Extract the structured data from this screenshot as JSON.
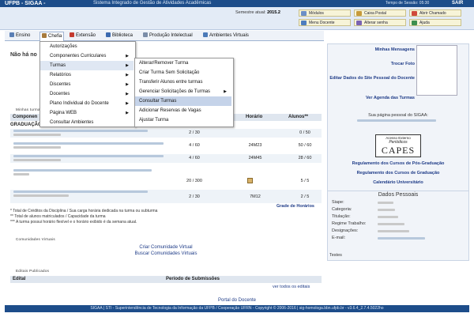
{
  "header": {
    "brand": "UFPB - SIGAA -",
    "subtitle": "Sistema Integrado de Gestão de Atividades Acadêmicas",
    "timer": "Tempo de Sessão: 05:30",
    "logout": "SAIR",
    "semester_label": "Semestre atual:",
    "semester_value": "2015.2"
  },
  "quick_links": [
    {
      "label": "Módulos",
      "color": "#6b8fc7"
    },
    {
      "label": "Caixa Postal",
      "color": "#c79a3b"
    },
    {
      "label": "Abrir Chamado",
      "color": "#d04a3a"
    },
    {
      "label": "Menu Docente",
      "color": "#4c7dbf"
    },
    {
      "label": "Alterar senha",
      "color": "#7a63b2"
    },
    {
      "label": "Ajuda",
      "color": "#3d8f4f"
    }
  ],
  "menu": [
    "Ensino",
    "Chefia",
    "Extensão",
    "Biblioteca",
    "Produção Intelectual",
    "Ambientes Virtuais"
  ],
  "chefia_menu": [
    "Autorizações",
    "Componentes Curriculares",
    "Turmas",
    "Relatórios",
    "Discentes",
    "Docentes",
    "Plano Individual do Docente",
    "Página WEB",
    "Consultar Ambientes"
  ],
  "turmas_menu": [
    "Alterar/Remover Turma",
    "Criar Turma Sem Solicitação",
    "Transferir Alunos entre turmas",
    "Gerenciar Solicitações de Turmas",
    "Consultar Turmas",
    "Adicionar Reservas de Vagas",
    "Ajustar Turma"
  ],
  "main": {
    "notice": "Não há no",
    "minhas_turmas_title": "Minhas turmas",
    "table_headers": {
      "componente": "Componen",
      "horario": "Horário",
      "alunos": "Alunos**"
    },
    "graduacao": "GRADUAÇÃO",
    "rows": [
      {
        "vagas": "2 / 30",
        "horario": "",
        "alunos": "0 / 50"
      },
      {
        "vagas": "4 / 60",
        "horario": "24M23",
        "alunos": "50 / 60"
      },
      {
        "vagas": "4 / 60",
        "horario": "24M45",
        "alunos": "28 / 60"
      },
      {
        "vagas": "20 / 300",
        "horario": "",
        "alunos": "5 / 5"
      },
      {
        "vagas": "2 / 30",
        "horario": "7M12",
        "alunos": "2 / 5"
      }
    ],
    "notes": [
      "* Total de Créditos da Disciplina / Sua carga horária dedicada na turma ou subturma",
      "** Total de alunos matriculados / Capacidade da turma",
      "*** A turma possui horário flexível e o horário exibido é da semana atual."
    ],
    "grade_link": "Grade de Horários",
    "comunidades_title": "Comunidades Virtuais",
    "criar_comunidade": "Criar Comunidade Virtual",
    "buscar_comunidades": "Buscar Comunidades Virtuais",
    "editais_title": "Editais Publicados",
    "edital_col": "Edital",
    "periodo_col": "Período de Submissões",
    "ver_todos": "ver todos os editais",
    "portal": "Portal do Docente"
  },
  "sidebar": {
    "links": [
      "Minhas Mensagens",
      "Trocar Foto",
      "Editar Dados do Site Pessoal do Docente",
      "Ver Agenda das Turmas"
    ],
    "pagina_pessoal": "Sua página pessoal do SIGAA:",
    "capes_line1": "Acesso Externo",
    "capes_line2": "Periódicos",
    "capes_line3": "CAPES",
    "regulamentos": [
      "Regulamento dos Cursos de Pós-Graduação",
      "Regulamento dos Cursos de Graduação",
      "Calendário Universitário"
    ],
    "dados_title": "Dados Pessoais",
    "dados_labels": [
      "Siape:",
      "Categoria:",
      "Titulação:",
      "Regime Trabalho:",
      "Designações:",
      "E-mail:"
    ],
    "testes": "Testes"
  },
  "footer": "SIGAA | STI - Superintendência de Tecnologia da Informação da UFPB / Cooperação UFRN - Copyright © 2006-2016 | sig-homologa.bbn.ufpb.br - v3.6.4_2.7.4.5022ho"
}
